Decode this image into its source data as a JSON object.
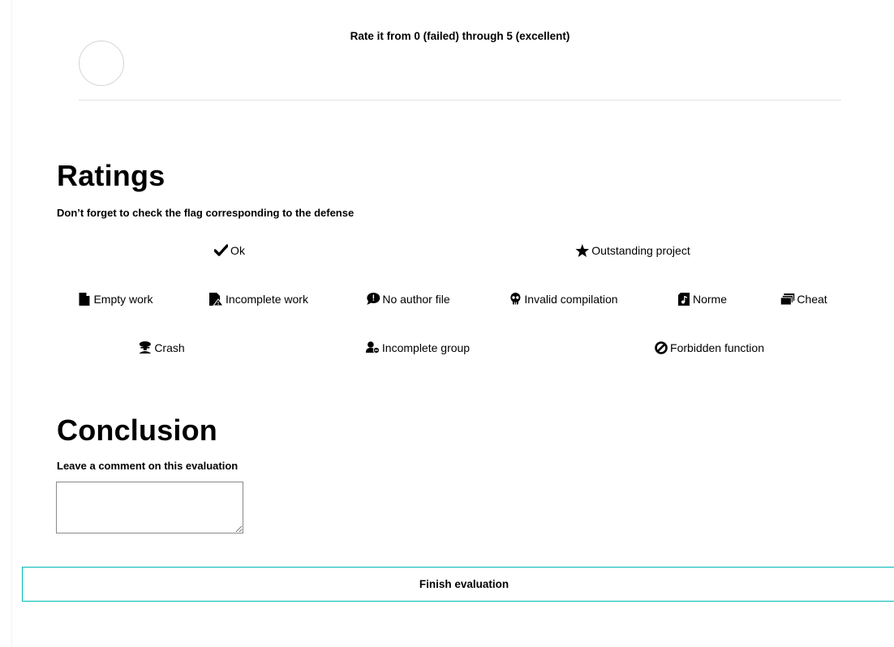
{
  "rating": {
    "caption": "Rate it from 0 (failed) through 5 (excellent)"
  },
  "ratings": {
    "title": "Ratings",
    "subtitle": "Don’t forget to check the flag corresponding to the defense",
    "flags": {
      "ok": {
        "label": "Ok",
        "icon": "check-icon"
      },
      "outstanding": {
        "label": "Outstanding project",
        "icon": "star-icon"
      },
      "empty_work": {
        "label": "Empty work",
        "icon": "file-icon"
      },
      "incomplete_work": {
        "label": "Incomplete work",
        "icon": "file-warning-icon"
      },
      "no_author_file": {
        "label": "No author file",
        "icon": "speech-bubble-icon"
      },
      "invalid_compilation": {
        "label": "Invalid compilation",
        "icon": "skull-icon"
      },
      "norme": {
        "label": "Norme",
        "icon": "music-file-icon"
      },
      "cheat": {
        "label": "Cheat",
        "icon": "cards-icon"
      },
      "crash": {
        "label": "Crash",
        "icon": "mushroom-cloud-icon"
      },
      "incomplete_group": {
        "label": "Incomplete group",
        "icon": "user-minus-icon"
      },
      "forbidden_function": {
        "label": "Forbidden function",
        "icon": "ban-icon"
      }
    }
  },
  "conclusion": {
    "title": "Conclusion",
    "subtitle": "Leave a comment on this evaluation",
    "comment_value": ""
  },
  "finish_button": {
    "label": "Finish evaluation"
  },
  "colors": {
    "accent": "#00bab5",
    "text": "#000000",
    "divider": "#e4e4e4"
  }
}
